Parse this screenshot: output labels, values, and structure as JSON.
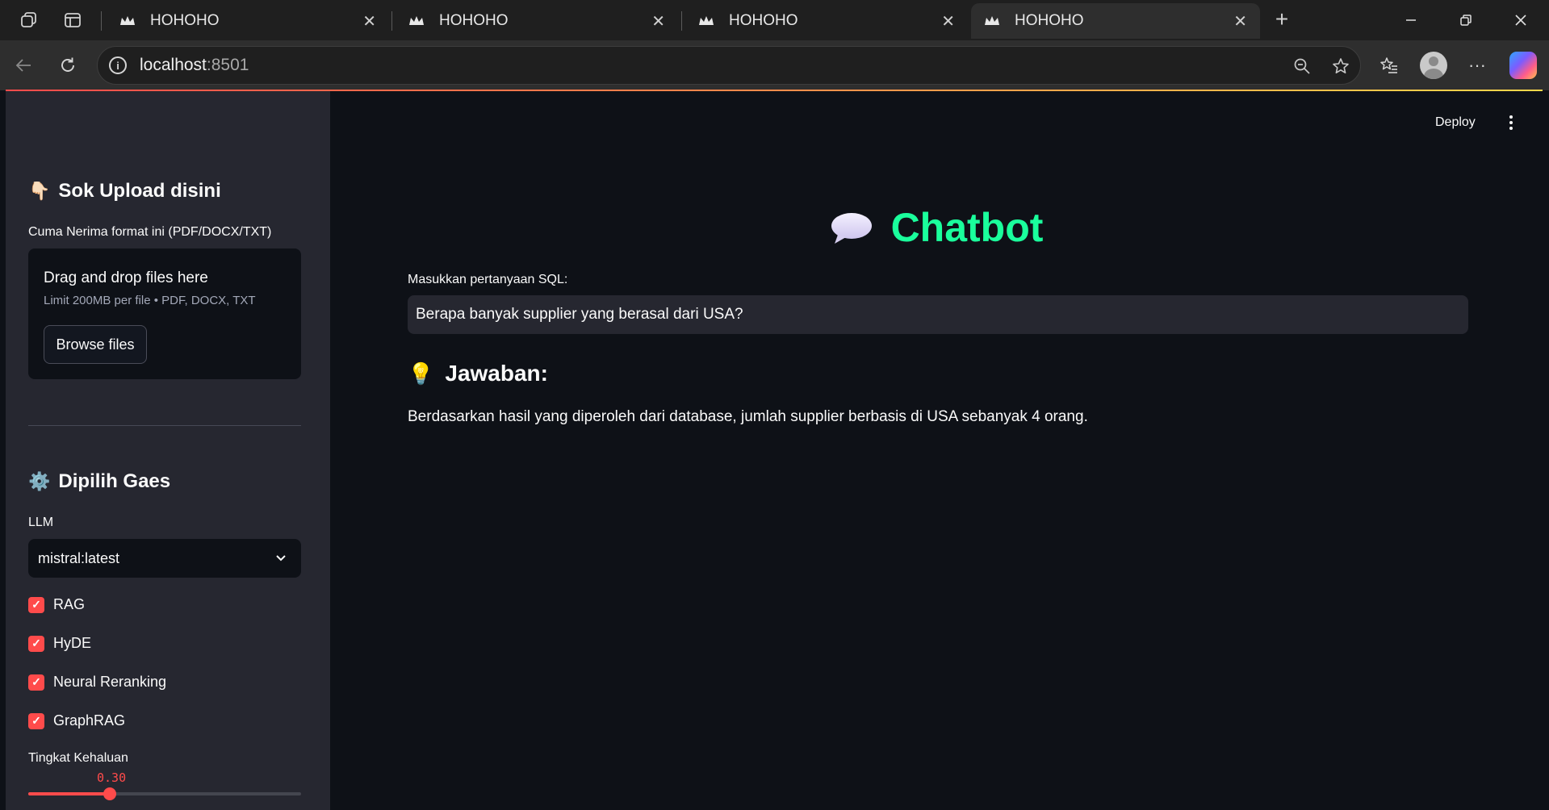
{
  "browser": {
    "tabs": [
      {
        "title": "HOHOHO",
        "active": false
      },
      {
        "title": "HOHOHO",
        "active": false
      },
      {
        "title": "HOHOHO",
        "active": false
      },
      {
        "title": "HOHOHO",
        "active": true
      }
    ],
    "url_host": "localhost",
    "url_port": ":8501",
    "window_controls": [
      "minimize",
      "restore",
      "close"
    ]
  },
  "sidebar": {
    "upload_header": "Sok Upload disini",
    "upload_header_emoji": "👇🏻",
    "upload_label": "Cuma Nerima format ini (PDF/DOCX/TXT)",
    "dropzone_title": "Drag and drop files here",
    "dropzone_limit": "Limit 200MB per file • PDF, DOCX, TXT",
    "browse_button": "Browse files",
    "settings_header": "Dipilih Gaes",
    "settings_header_emoji": "⚙️",
    "llm_label": "LLM",
    "llm_selected": "mistral:latest",
    "checkboxes": [
      {
        "label": "RAG",
        "checked": true
      },
      {
        "label": "HyDE",
        "checked": true
      },
      {
        "label": "Neural Reranking",
        "checked": true
      },
      {
        "label": "GraphRAG",
        "checked": true
      }
    ],
    "slider_label": "Tingkat Kehaluan",
    "slider_value": "0.30",
    "slider_fraction": 0.3
  },
  "main": {
    "deploy_label": "Deploy",
    "title": "Chatbot",
    "title_emoji": "💬",
    "question_label": "Masukkan pertanyaan SQL:",
    "question_value": "Berapa banyak supplier yang berasal dari USA?",
    "answer_header": "Jawaban:",
    "answer_header_emoji": "💡",
    "answer_text": "Berdasarkan hasil yang diperoleh dari database, jumlah supplier berbasis di USA sebanyak 4 orang."
  },
  "colors": {
    "accent": "#ff4b4b",
    "title_green": "#1aff9c",
    "app_bg": "#0e1117",
    "sidebar_bg": "#262730"
  }
}
